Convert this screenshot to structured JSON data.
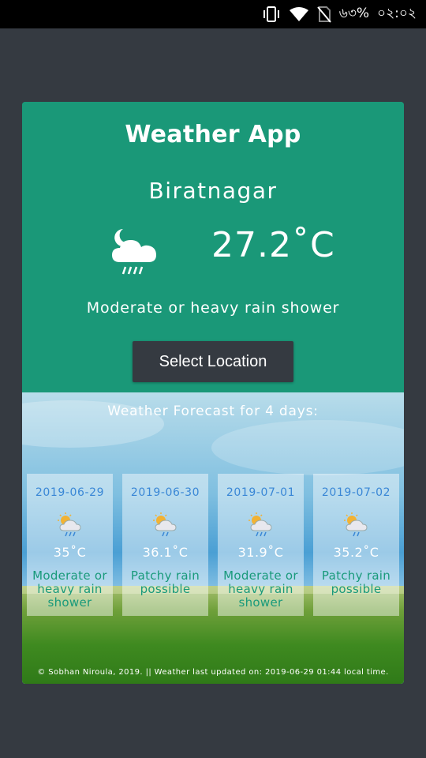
{
  "status_bar": {
    "battery": "৬৩%",
    "time": "০২:০২"
  },
  "app": {
    "title": "Weather App",
    "city": "Biratnagar",
    "current_icon": "moon-rain-cloud-icon",
    "temperature": "27.2˚C",
    "condition": "Moderate or heavy rain shower",
    "select_button": "Select Location"
  },
  "forecast": {
    "title": "Weather Forecast for 4 days:",
    "days": [
      {
        "date": "2019-06-29",
        "icon": "sun-rain-cloud-icon",
        "temp": "35˚C",
        "condition": "Moderate or heavy rain shower"
      },
      {
        "date": "2019-06-30",
        "icon": "sun-rain-cloud-icon",
        "temp": "36.1˚C",
        "condition": "Patchy rain possible"
      },
      {
        "date": "2019-07-01",
        "icon": "sun-rain-cloud-icon",
        "temp": "31.9˚C",
        "condition": "Moderate or heavy rain shower"
      },
      {
        "date": "2019-07-02",
        "icon": "sun-rain-cloud-icon",
        "temp": "35.2˚C",
        "condition": "Patchy rain possible"
      }
    ]
  },
  "footer": "© Sobhan Niroula, 2019. || Weather last updated on: 2019-06-29 01:44 local time.",
  "colors": {
    "page_background": "#353a41",
    "card_green": "#1a9878",
    "button_dark": "#353a41",
    "forecast_date_blue": "#3a87d6",
    "forecast_condition_green": "#199a7b"
  }
}
